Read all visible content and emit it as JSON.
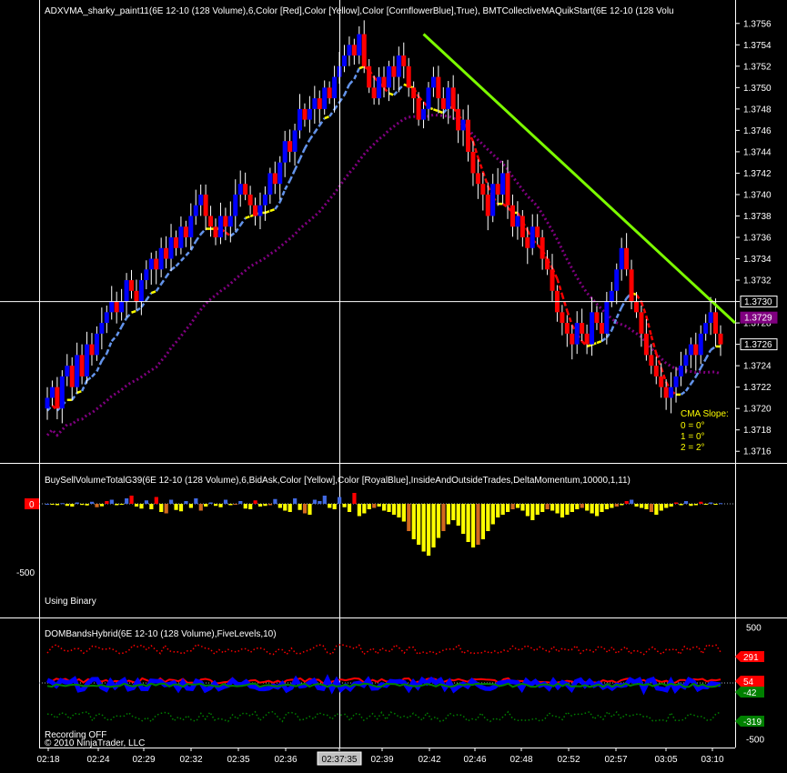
{
  "chart_data": [
    {
      "type": "candlestick",
      "title": "ADXVMA_sharky_paint11(6E 12-10 (128 Volume),6,Color [Red],Color [Yellow],Color [CornflowerBlue],True), BMTCollectiveMAQuikStart(6E 12-10 (128 Volu",
      "ylim": [
        1.3715,
        1.3757
      ],
      "yticks": [
        "1.3756",
        "1.3754",
        "1.3752",
        "1.3750",
        "1.3748",
        "1.3746",
        "1.3744",
        "1.3742",
        "1.3740",
        "1.3738",
        "1.3736",
        "1.3734",
        "1.3732",
        "1.3730",
        "1.3728",
        "1.3726",
        "1.3724",
        "1.3722",
        "1.3720",
        "1.3718",
        "1.3716"
      ],
      "price_badges": [
        {
          "value": "1.3730",
          "price": 1.373,
          "bg": "#000000",
          "fg": "#ffffff",
          "border": "#ffffff"
        },
        {
          "value": "1.3729",
          "price": 1.37285,
          "bg": "#800080",
          "fg": "#ffffff",
          "border": "#800080"
        },
        {
          "value": "1.3726",
          "price": 1.3726,
          "bg": "#000000",
          "fg": "#ffffff",
          "border": "#ffffff"
        }
      ],
      "crosshair_price": 1.373,
      "closes": [
        1.3721,
        1.3722,
        1.372,
        1.3723,
        1.3724,
        1.3722,
        1.3725,
        1.3723,
        1.3726,
        1.3725,
        1.3727,
        1.3728,
        1.3729,
        1.373,
        1.3729,
        1.373,
        1.3732,
        1.3731,
        1.373,
        1.3732,
        1.3733,
        1.3734,
        1.3733,
        1.3735,
        1.3734,
        1.3736,
        1.3735,
        1.3737,
        1.3736,
        1.3738,
        1.3739,
        1.374,
        1.3738,
        1.3737,
        1.3736,
        1.3738,
        1.3737,
        1.3738,
        1.374,
        1.3741,
        1.374,
        1.3739,
        1.3738,
        1.3739,
        1.374,
        1.3742,
        1.3741,
        1.3743,
        1.3745,
        1.3744,
        1.3746,
        1.3748,
        1.3747,
        1.3748,
        1.3749,
        1.3748,
        1.375,
        1.3749,
        1.3751,
        1.3752,
        1.3753,
        1.3754,
        1.3753,
        1.3755,
        1.3752,
        1.375,
        1.3749,
        1.3751,
        1.375,
        1.3752,
        1.3751,
        1.3753,
        1.3752,
        1.375,
        1.3749,
        1.3747,
        1.3748,
        1.375,
        1.3751,
        1.3749,
        1.3748,
        1.375,
        1.3748,
        1.3746,
        1.3747,
        1.3744,
        1.3742,
        1.3741,
        1.374,
        1.3738,
        1.3741,
        1.374,
        1.3742,
        1.3739,
        1.3737,
        1.3738,
        1.3736,
        1.3735,
        1.3737,
        1.3736,
        1.3734,
        1.3733,
        1.3731,
        1.3729,
        1.3728,
        1.3727,
        1.3726,
        1.3728,
        1.3727,
        1.3726,
        1.3729,
        1.3728,
        1.3727,
        1.373,
        1.3731,
        1.3733,
        1.3735,
        1.3733,
        1.373,
        1.3729,
        1.3727,
        1.3725,
        1.3724,
        1.3723,
        1.3722,
        1.3721,
        1.3722,
        1.3723,
        1.3724,
        1.3725,
        1.3726,
        1.3725,
        1.3727,
        1.3728,
        1.3729,
        1.3727,
        1.3726
      ],
      "trendline": {
        "from_index": 76,
        "from_price": 1.3755,
        "to_index": 180,
        "to_price": 1.3728,
        "color": "#7cfc00"
      },
      "cma": {
        "title": "CMA Slope:",
        "lines": [
          "0 = 0°",
          "1 = 0°",
          "2 = 2°"
        ]
      }
    },
    {
      "type": "bar",
      "title": "BuySellVolumeTotalG39(6E 12-10 (128 Volume),6,BidAsk,Color [Yellow],Color [RoyalBlue],InsideAndOutsideTrades,DeltaMomentum,10000,1,11)",
      "ylim": [
        -820,
        280
      ],
      "yticks": [
        "-500"
      ],
      "zero_badge": "0",
      "note": "Using Binary",
      "bars": [
        0,
        -5,
        -10,
        5,
        -15,
        -20,
        10,
        -8,
        -12,
        15,
        -25,
        -18,
        20,
        30,
        -10,
        -5,
        40,
        60,
        -20,
        -35,
        25,
        -40,
        50,
        -60,
        -70,
        30,
        -45,
        -55,
        20,
        -30,
        40,
        -50,
        -20,
        10,
        -15,
        -25,
        30,
        -10,
        -5,
        20,
        -35,
        -40,
        25,
        -20,
        -15,
        -10,
        35,
        -30,
        -50,
        -60,
        40,
        -45,
        -70,
        -80,
        30,
        20,
        60,
        -30,
        -40,
        50,
        -25,
        -60,
        80,
        -90,
        -70,
        -40,
        -30,
        -20,
        -50,
        -60,
        -80,
        -100,
        -130,
        -200,
        -260,
        -300,
        -350,
        -380,
        -320,
        -250,
        -200,
        -150,
        -120,
        -160,
        -220,
        -280,
        -320,
        -300,
        -260,
        -200,
        -150,
        -100,
        -80,
        -60,
        -40,
        -30,
        -50,
        -90,
        -120,
        -80,
        -60,
        -40,
        -50,
        -70,
        -100,
        -80,
        -60,
        -40,
        -30,
        -50,
        -70,
        -90,
        -60,
        -40,
        -30,
        -20,
        -10,
        20,
        30,
        -20,
        -30,
        -40,
        -60,
        -80,
        -50,
        -30,
        -20,
        10,
        -10,
        20,
        -15,
        -10,
        15,
        -5,
        10,
        -5,
        5
      ],
      "positive_color": "#4169e1",
      "negative_color": "#ffff00",
      "accent_colors": [
        "#ff0000",
        "#d2691e"
      ]
    },
    {
      "type": "line",
      "title": "DOMBandsHybrid(6E 12-10 (128 Volume),FiveLevels,10)",
      "ylim": [
        -560,
        560
      ],
      "yticks": [
        "500",
        "-500"
      ],
      "badges": [
        {
          "value": "291",
          "color": "#ff0000"
        },
        {
          "value": "54",
          "color": "#ff0000"
        },
        {
          "value": "-42",
          "color": "#008000"
        },
        {
          "value": "-319",
          "color": "#008000"
        }
      ],
      "series": [
        {
          "color": "#ff0000",
          "style": "dotted"
        },
        {
          "color": "#ff0000",
          "style": "solid"
        },
        {
          "color": "#0000ff",
          "style": "solid"
        },
        {
          "color": "#008000",
          "style": "solid"
        },
        {
          "color": "#008000",
          "style": "dotted"
        }
      ]
    }
  ],
  "xaxis": {
    "labels": [
      "02:18",
      "02:24",
      "02:29",
      "02:32",
      "02:35",
      "02:36",
      "02:37:35",
      "02:39",
      "02:42",
      "02:46",
      "02:48",
      "02:52",
      "02:57",
      "03:05",
      "03:10"
    ],
    "highlight_label": "02:37:35"
  },
  "footer": {
    "recording": "Recording OFF",
    "copyright": "© 2010 NinjaTrader, LLC"
  },
  "colors": {
    "up_bar": "#0000ff",
    "down_bar": "#ff0000",
    "wick": "#ffffff",
    "adxvma": "#6495ed",
    "adxvma_flat": "#ffff00",
    "adxvma_down": "#ff0000",
    "collective_ma": "#800080",
    "grid": "#ffffff"
  }
}
